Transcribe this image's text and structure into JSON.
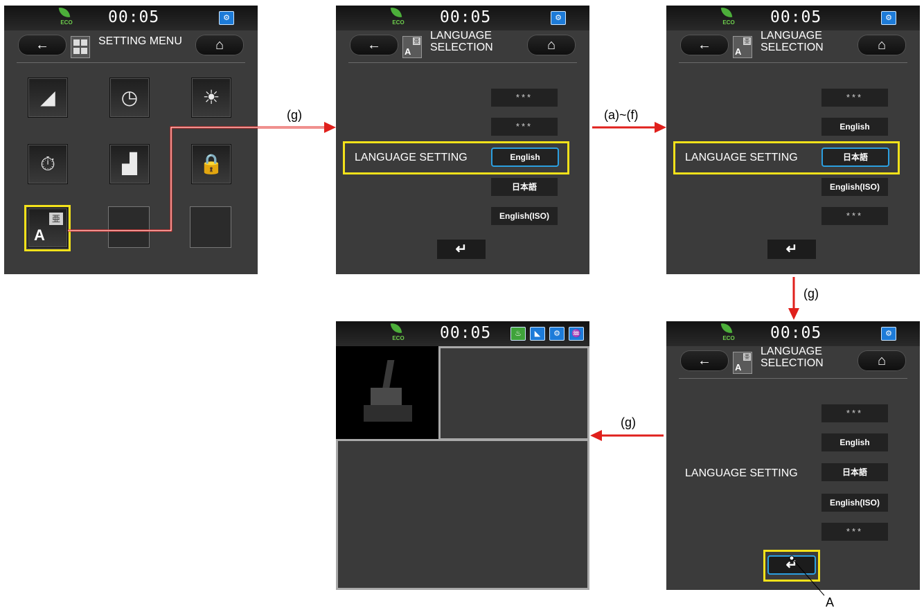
{
  "time": "00:05",
  "eco_label": "ECO",
  "colors": {
    "highlight": "#f4e21a",
    "arrow": "#e0201c",
    "selected_border": "#2b9fe0",
    "status_blue": "#1d7bd8",
    "status_green": "#3fa33a"
  },
  "icons": {
    "back": "←",
    "home": "⌂",
    "enter": "↵"
  },
  "screens": {
    "setting_menu": {
      "title": "SETTING MENU",
      "menu_icons": [
        "camera-icon",
        "clock-icon",
        "brightness-icon",
        "maintenance-timer-icon",
        "equalizer-icon",
        "security-lock-icon",
        "language-icon"
      ]
    },
    "lang1": {
      "title_line1": "LANGUAGE",
      "title_line2": "SELECTION",
      "label": "LANGUAGE SETTING",
      "options": [
        "***",
        "***",
        "English",
        "日本語",
        "English(ISO)"
      ]
    },
    "lang2": {
      "title_line1": "LANGUAGE",
      "title_line2": "SELECTION",
      "label": "LANGUAGE SETTING",
      "options": [
        "***",
        "English",
        "日本語",
        "English(ISO)",
        "***"
      ]
    },
    "lang3": {
      "title_line1": "LANGUAGE",
      "title_line2": "SELECTION",
      "label": "LANGUAGE SETTING",
      "options": [
        "***",
        "English",
        "日本語",
        "English(ISO)",
        "***"
      ]
    }
  },
  "flow_labels": {
    "g1": "(g)",
    "af": "(a)~(f)",
    "g2": "(g)",
    "g3": "(g)"
  },
  "callout": "A"
}
